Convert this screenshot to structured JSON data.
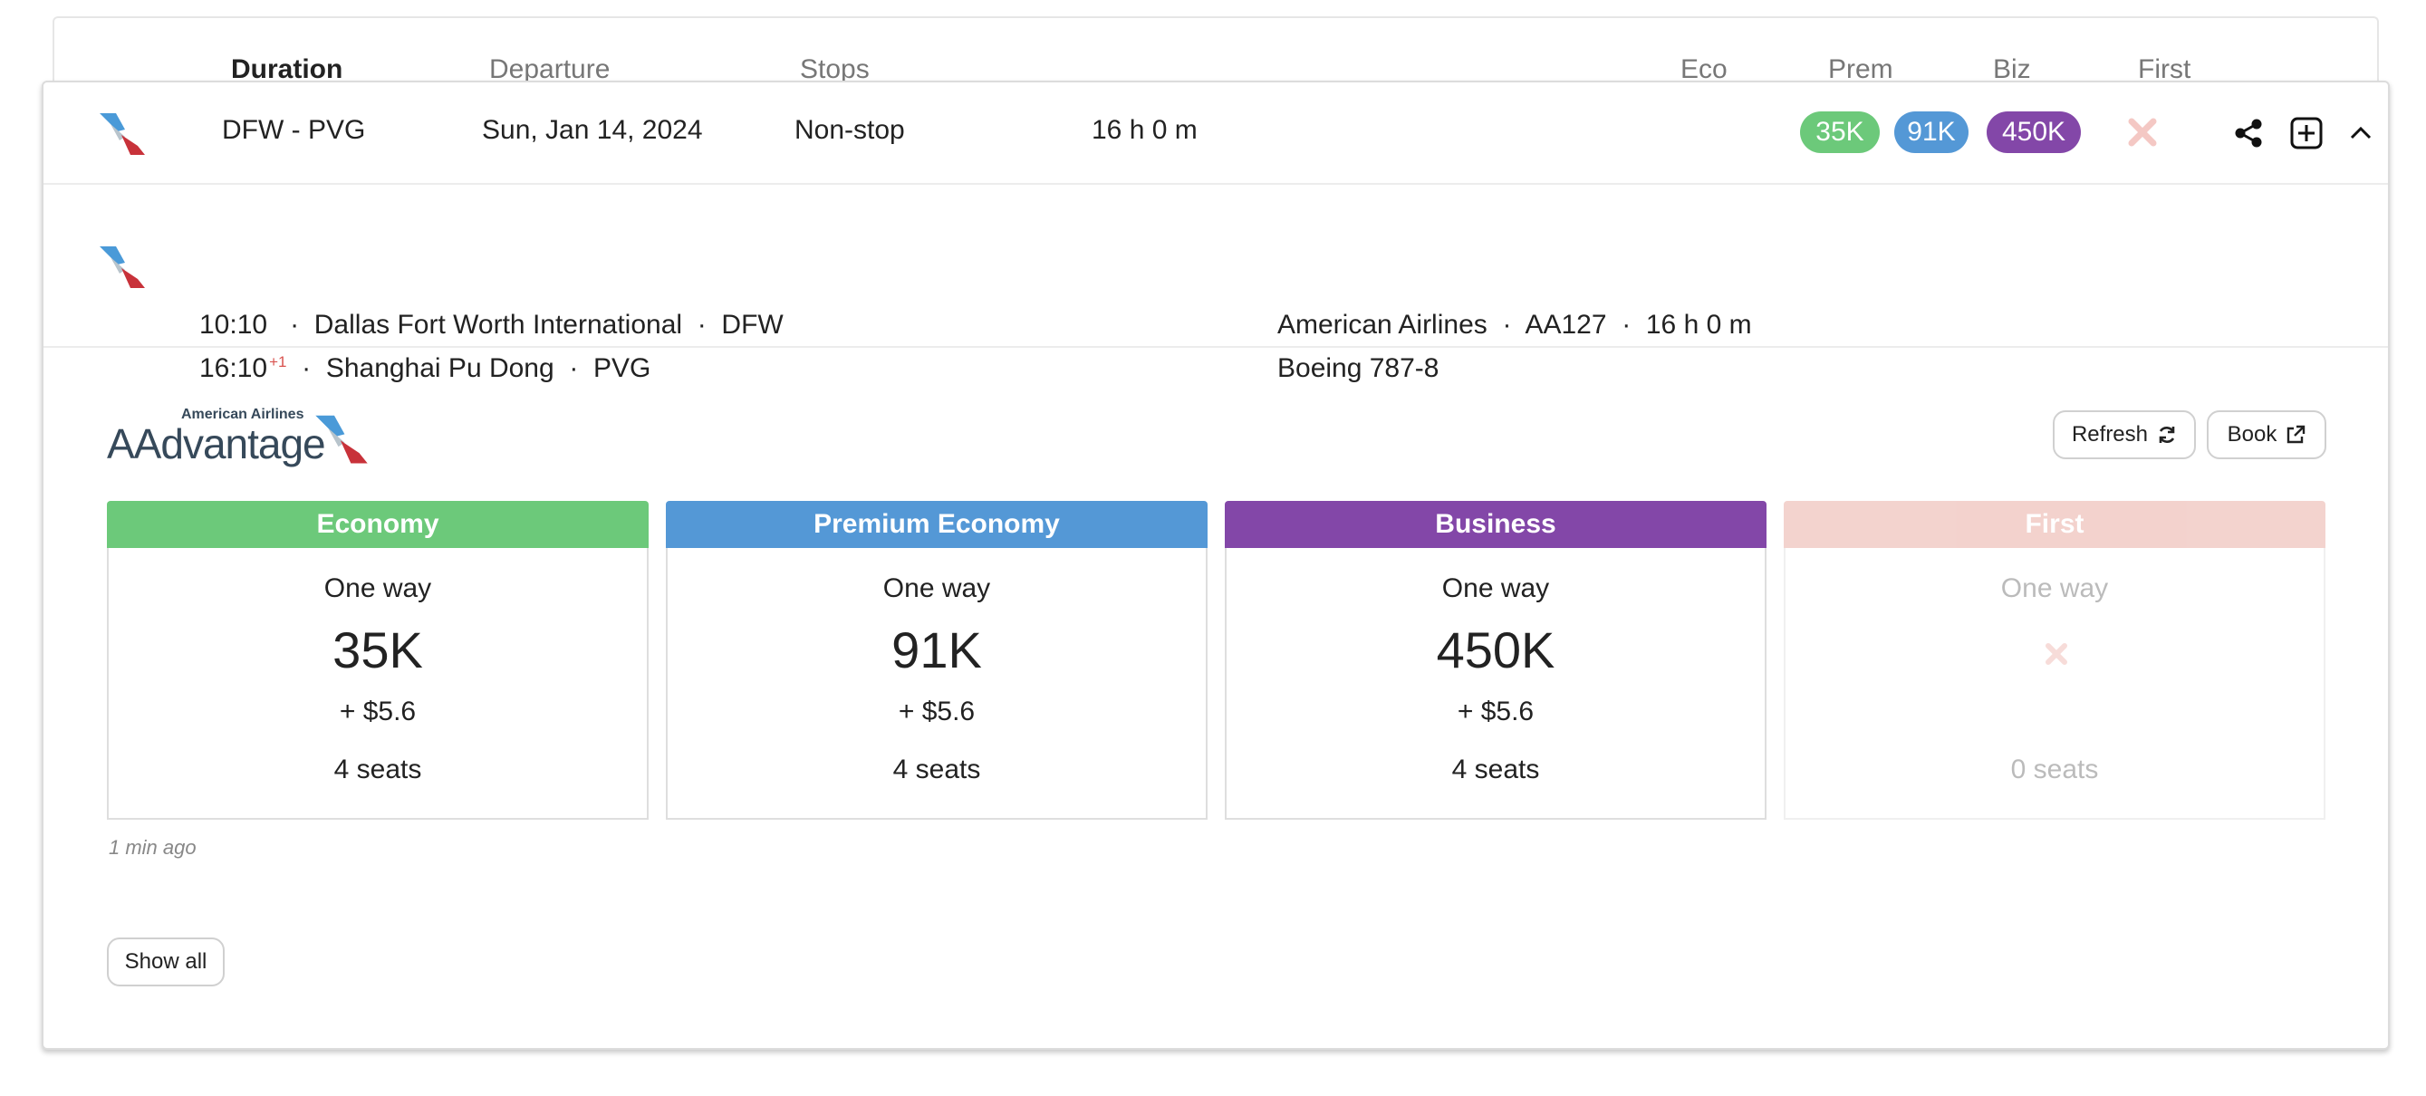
{
  "columns": {
    "duration": "Duration",
    "departure": "Departure",
    "stops": "Stops",
    "eco": "Eco",
    "prem": "Prem",
    "biz": "Biz",
    "first": "First"
  },
  "flight": {
    "route": "DFW - PVG",
    "date": "Sun, Jan 14, 2024",
    "stops": "Non-stop",
    "duration": "16 h 0 m",
    "badges": {
      "eco": "35K",
      "prem": "91K",
      "biz": "450K"
    }
  },
  "segment": {
    "dep_time": "10:10",
    "dep_airport": "Dallas Fort Worth International",
    "dep_code": "DFW",
    "arr_time": "16:10",
    "arr_offset": "+1",
    "arr_airport": "Shanghai Pu Dong",
    "arr_code": "PVG",
    "airline": "American Airlines",
    "flight_no": "AA127",
    "duration": "16 h 0 m",
    "aircraft": "Boeing 787-8",
    "sep": "·"
  },
  "program": {
    "small": "American Airlines",
    "big": "AAdvantage"
  },
  "actions": {
    "refresh": "Refresh",
    "book": "Book",
    "show_all": "Show all"
  },
  "fares": [
    {
      "cabin": "Economy",
      "type": "One way",
      "miles": "35K",
      "tax": "+ $5.6",
      "seats": "4 seats"
    },
    {
      "cabin": "Premium Economy",
      "type": "One way",
      "miles": "91K",
      "tax": "+ $5.6",
      "seats": "4 seats"
    },
    {
      "cabin": "Business",
      "type": "One way",
      "miles": "450K",
      "tax": "+ $5.6",
      "seats": "4 seats"
    },
    {
      "cabin": "First",
      "type": "One way",
      "miles": "",
      "tax": "",
      "seats": "0 seats"
    }
  ],
  "updated": "1 min ago",
  "colors": {
    "economy": "#6cc97a",
    "premium": "#5498d6",
    "business": "#8347a8",
    "first": "#eeb6ae",
    "unavailable": "#f4c8c4"
  },
  "icons": [
    "aa-logo-icon",
    "share-icon",
    "add-box-icon",
    "chevron-up-icon",
    "close-icon",
    "refresh-icon",
    "external-link-icon"
  ]
}
